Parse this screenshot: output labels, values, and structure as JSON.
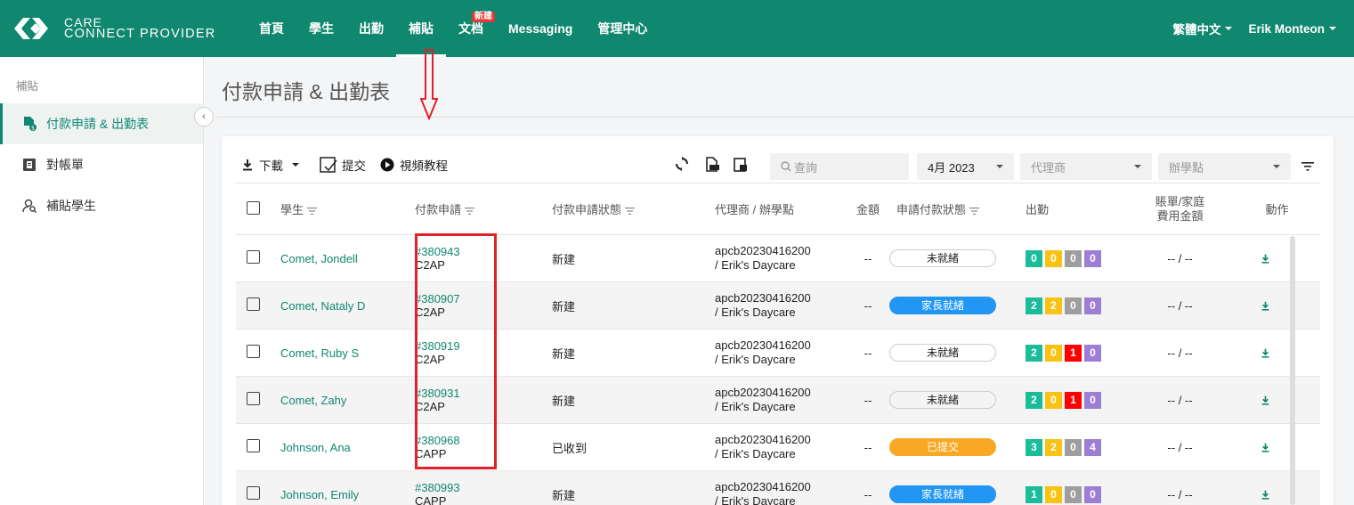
{
  "brand": {
    "line1": "CARE",
    "line2": "CONNECT PROVIDER"
  },
  "nav": {
    "items": [
      {
        "label": "首頁",
        "name": "nav-home"
      },
      {
        "label": "學生",
        "name": "nav-students"
      },
      {
        "label": "出勤",
        "name": "nav-attendance"
      },
      {
        "label": "補貼",
        "name": "nav-subsidy",
        "active": true
      },
      {
        "label": "文档",
        "name": "nav-documents",
        "badge": "新建"
      },
      {
        "label": "Messaging",
        "name": "nav-messaging"
      },
      {
        "label": "管理中心",
        "name": "nav-admin"
      }
    ],
    "language": "繁體中文",
    "user": "Erik Monteon"
  },
  "sidebar": {
    "section": "補貼",
    "items": [
      {
        "label": "付款申請 & 出勤表",
        "icon": "document-dollar-icon",
        "active": true
      },
      {
        "label": "對帳單",
        "icon": "statement-icon"
      },
      {
        "label": "補貼學生",
        "icon": "person-search-icon"
      }
    ]
  },
  "page": {
    "title": "付款申請 & 出勤表"
  },
  "toolbar": {
    "download": "下載",
    "submit": "提交",
    "video": "視頻教程",
    "search_placeholder": "查詢",
    "month": "4月 2023",
    "agency_placeholder": "代理商",
    "site_placeholder": "辦學點"
  },
  "table": {
    "headers": {
      "student": "學生",
      "request": "付款申請",
      "request_status": "付款申請狀態",
      "agency": "代理商 / 辦學點",
      "amount": "金額",
      "apply_status": "申請付款狀態",
      "attendance": "出勤",
      "bill": "賬單/家庭",
      "bill2": "費用金額",
      "action": "動作"
    },
    "rows": [
      {
        "student": "Comet, Jondell",
        "id": "#380943",
        "type": "C2AP",
        "status": "新建",
        "agency": "apcb20230416200",
        "site": "/ Erik's Daycare",
        "amount": "--",
        "apply": "未就緒",
        "pill": "white",
        "att": [
          "0",
          "0",
          "0",
          "0"
        ],
        "att_colors": [
          "green",
          "yellow",
          "gray",
          "purple"
        ],
        "bill": "-- / --"
      },
      {
        "student": "Comet, Nataly D",
        "id": "#380907",
        "type": "C2AP",
        "status": "新建",
        "agency": "apcb20230416200",
        "site": "/ Erik's Daycare",
        "amount": "--",
        "apply": "家長就緒",
        "pill": "blue",
        "att": [
          "2",
          "2",
          "0",
          "0"
        ],
        "att_colors": [
          "green",
          "yellow",
          "gray",
          "purple"
        ],
        "bill": "-- / --"
      },
      {
        "student": "Comet, Ruby S",
        "id": "#380919",
        "type": "C2AP",
        "status": "新建",
        "agency": "apcb20230416200",
        "site": "/ Erik's Daycare",
        "amount": "--",
        "apply": "未就緒",
        "pill": "white",
        "att": [
          "2",
          "0",
          "1",
          "0"
        ],
        "att_colors": [
          "green",
          "yellow",
          "red",
          "purple"
        ],
        "bill": "-- / --"
      },
      {
        "student": "Comet, Zahy",
        "id": "#380931",
        "type": "C2AP",
        "status": "新建",
        "agency": "apcb20230416200",
        "site": "/ Erik's Daycare",
        "amount": "--",
        "apply": "未就緒",
        "pill": "white",
        "att": [
          "2",
          "0",
          "1",
          "0"
        ],
        "att_colors": [
          "green",
          "yellow",
          "red",
          "purple"
        ],
        "bill": "-- / --"
      },
      {
        "student": "Johnson, Ana",
        "id": "#380968",
        "type": "CAPP",
        "status": "已收到",
        "agency": "apcb20230416200",
        "site": "/ Erik's Daycare",
        "amount": "--",
        "apply": "已提交",
        "pill": "orange",
        "att": [
          "3",
          "2",
          "0",
          "4"
        ],
        "att_colors": [
          "green",
          "yellow",
          "gray",
          "purple"
        ],
        "bill": "-- / --"
      },
      {
        "student": "Johnson, Emily",
        "id": "#380993",
        "type": "CAPP",
        "status": "新建",
        "agency": "apcb20230416200",
        "site": "/ Erik's Daycare",
        "amount": "--",
        "apply": "家長就緒",
        "pill": "blue",
        "att": [
          "1",
          "0",
          "0",
          "0"
        ],
        "att_colors": [
          "green",
          "yellow",
          "gray",
          "purple"
        ],
        "bill": "-- / --"
      }
    ]
  },
  "colors": {
    "brand": "#10876f",
    "annotation": "#e0202a"
  }
}
